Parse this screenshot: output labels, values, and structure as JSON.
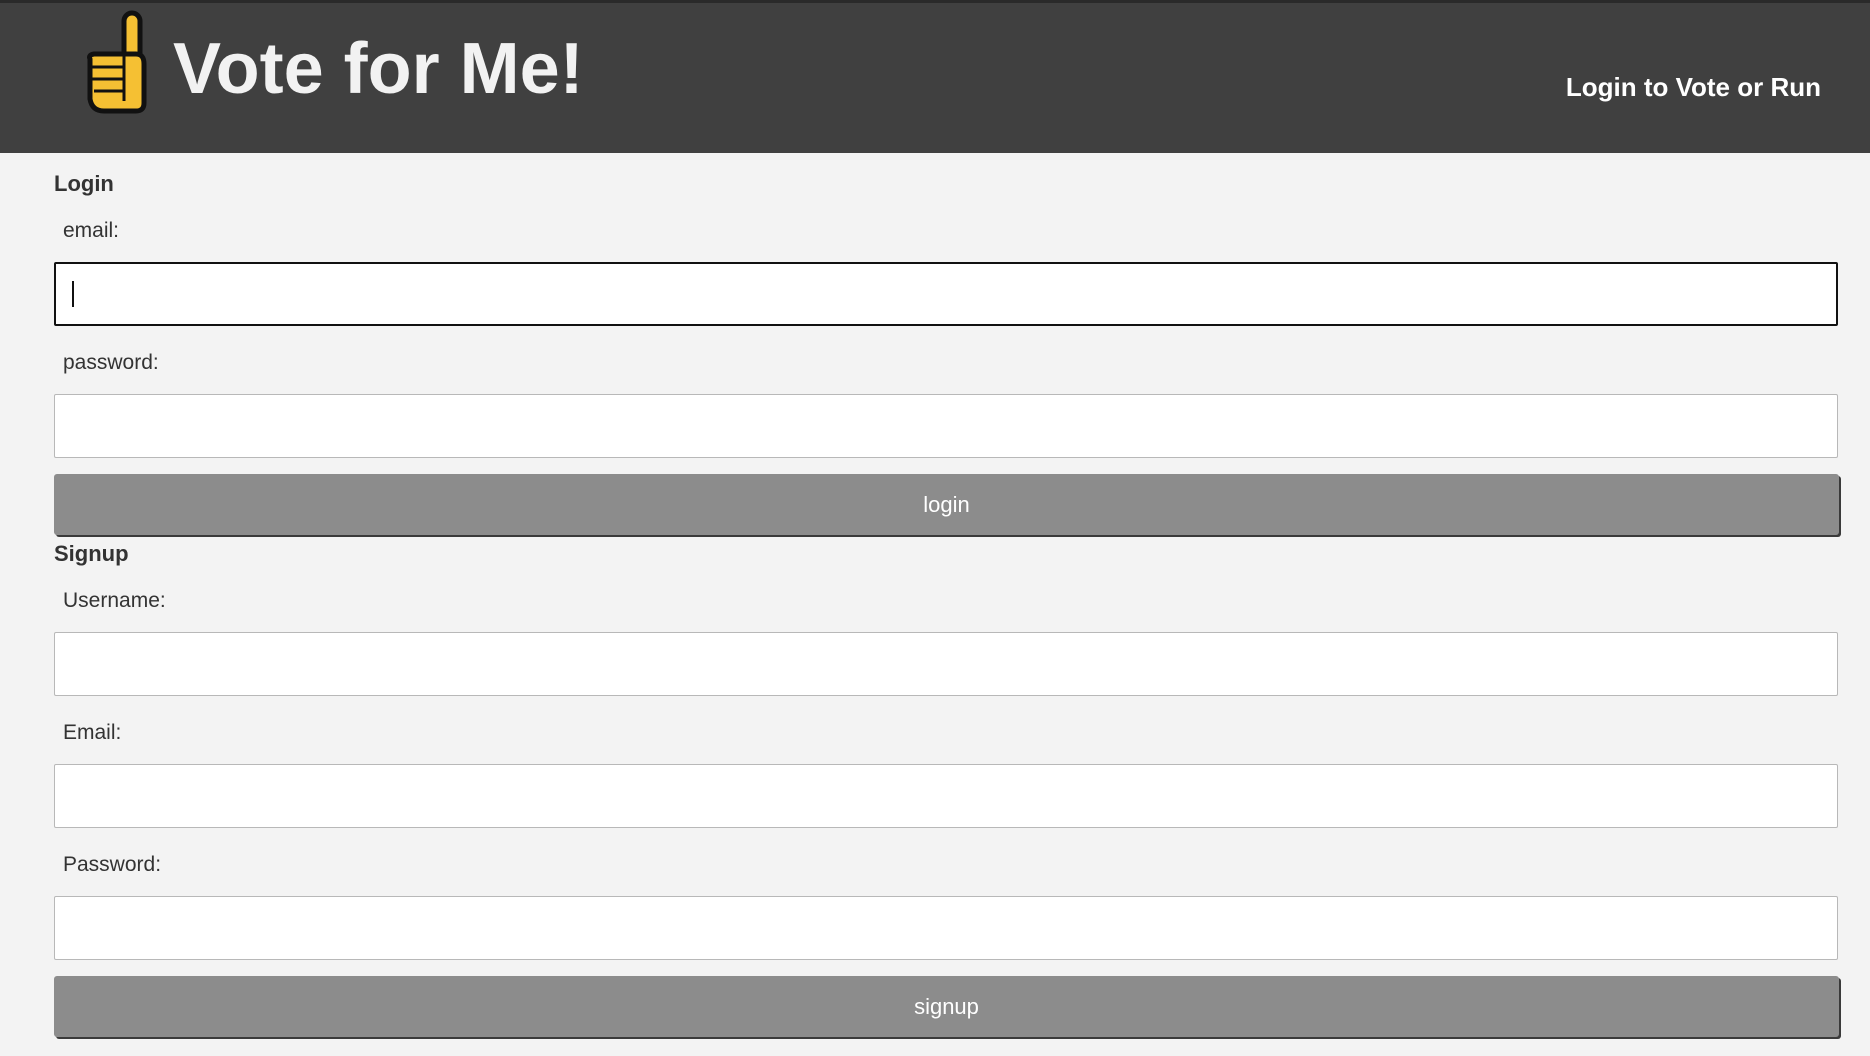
{
  "header": {
    "title": "Vote for Me!",
    "logo_icon": "index-finger-pointing-up-icon",
    "nav_link": "Login to Vote or Run"
  },
  "login": {
    "section_title": "Login",
    "email_label": "email:",
    "email_value": "",
    "password_label": "password:",
    "password_value": "",
    "button_label": "login"
  },
  "signup": {
    "section_title": "Signup",
    "username_label": "Username:",
    "username_value": "",
    "email_label": "Email:",
    "email_value": "",
    "password_label": "Password:",
    "password_value": "",
    "button_label": "signup"
  },
  "colors": {
    "header_bg": "#404040",
    "page_bg": "#f3f3f3",
    "button_bg": "#8c8c8c",
    "logo_yellow": "#f5c033"
  }
}
